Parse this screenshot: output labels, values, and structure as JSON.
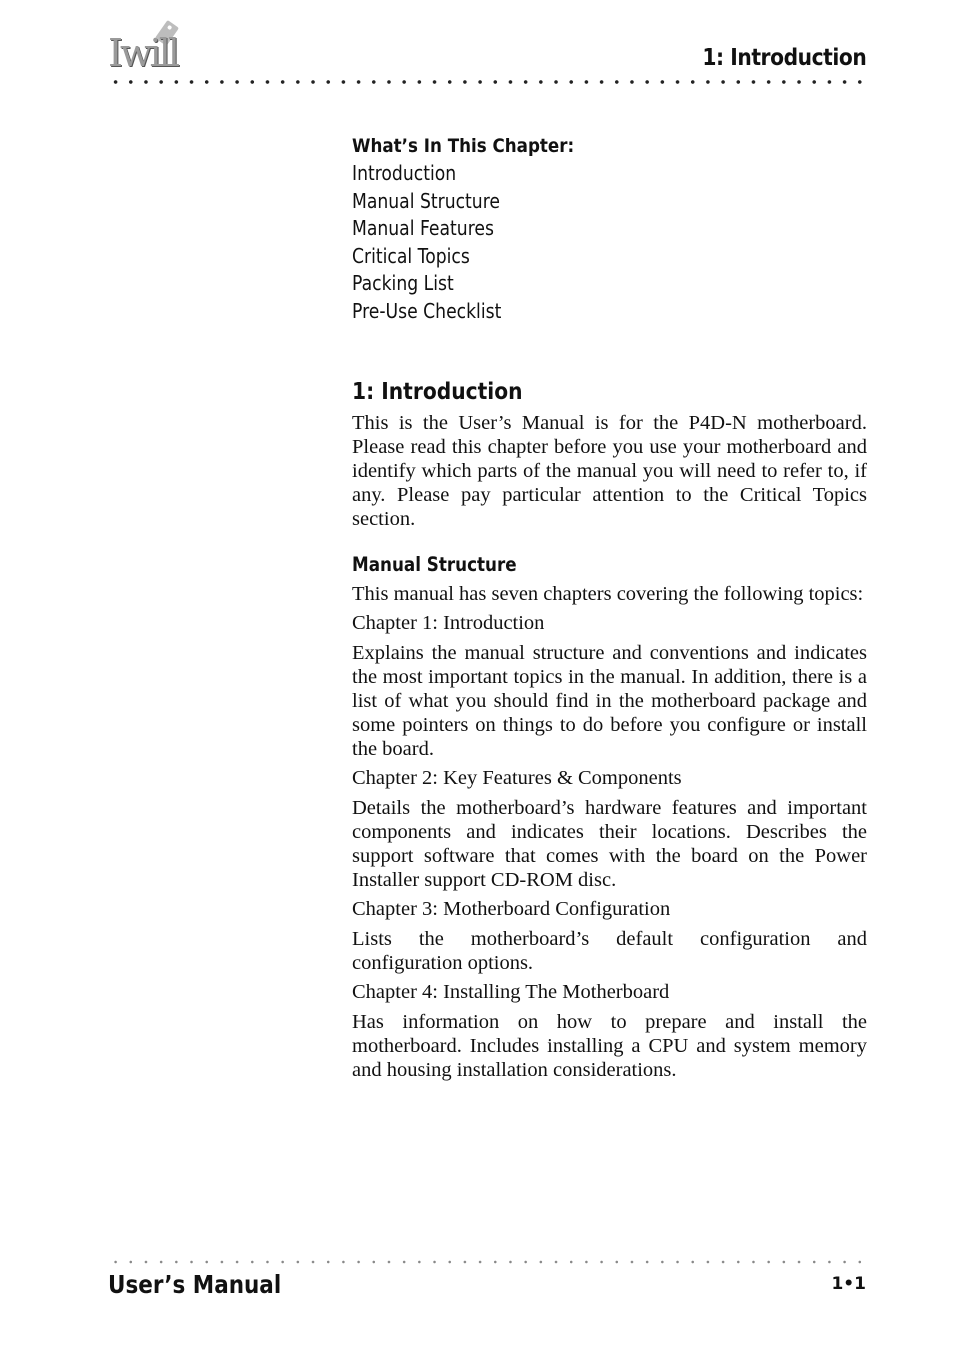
{
  "header": {
    "logo_text": "Iwill",
    "chapter_title": "1: Introduction"
  },
  "chapter_box": {
    "title": "What’s In This Chapter:",
    "items": [
      "Introduction",
      "Manual Structure",
      "Manual Features",
      "Critical Topics",
      "Packing List",
      "Pre-Use Checklist"
    ]
  },
  "section": {
    "title": "1: Introduction",
    "intro": "This is the User’s Manual is for the P4D-N motherboard. Please read this chapter before you use your motherboard and identify which parts of the manual you will need to refer to, if any. Please pay particular attention to the Critical Topics section."
  },
  "manual_structure": {
    "title": "Manual Structure",
    "intro": "This manual has seven chapters covering the following topics:",
    "chapters": [
      {
        "heading": "Chapter 1: Introduction",
        "description": "Explains the manual structure and conventions and indicates the most important topics in the manual. In addition, there is a list of what you should find in the motherboard package and some pointers on things to do before you configure or install the board."
      },
      {
        "heading": "Chapter 2: Key Features & Components",
        "description": "Details the motherboard’s hardware features and important components and indicates their locations. Describes the support software that comes with the board on the Power Installer support CD-ROM disc."
      },
      {
        "heading": "Chapter 3: Motherboard Configuration",
        "description": "Lists the motherboard’s default configuration and configuration options."
      },
      {
        "heading": "Chapter 4: Installing The Motherboard",
        "description": "Has information on how to prepare and install the motherboard. Includes installing a CPU and system memory and housing installation considerations."
      }
    ]
  },
  "footer": {
    "title": "User’s Manual",
    "page_number": "1•1"
  }
}
